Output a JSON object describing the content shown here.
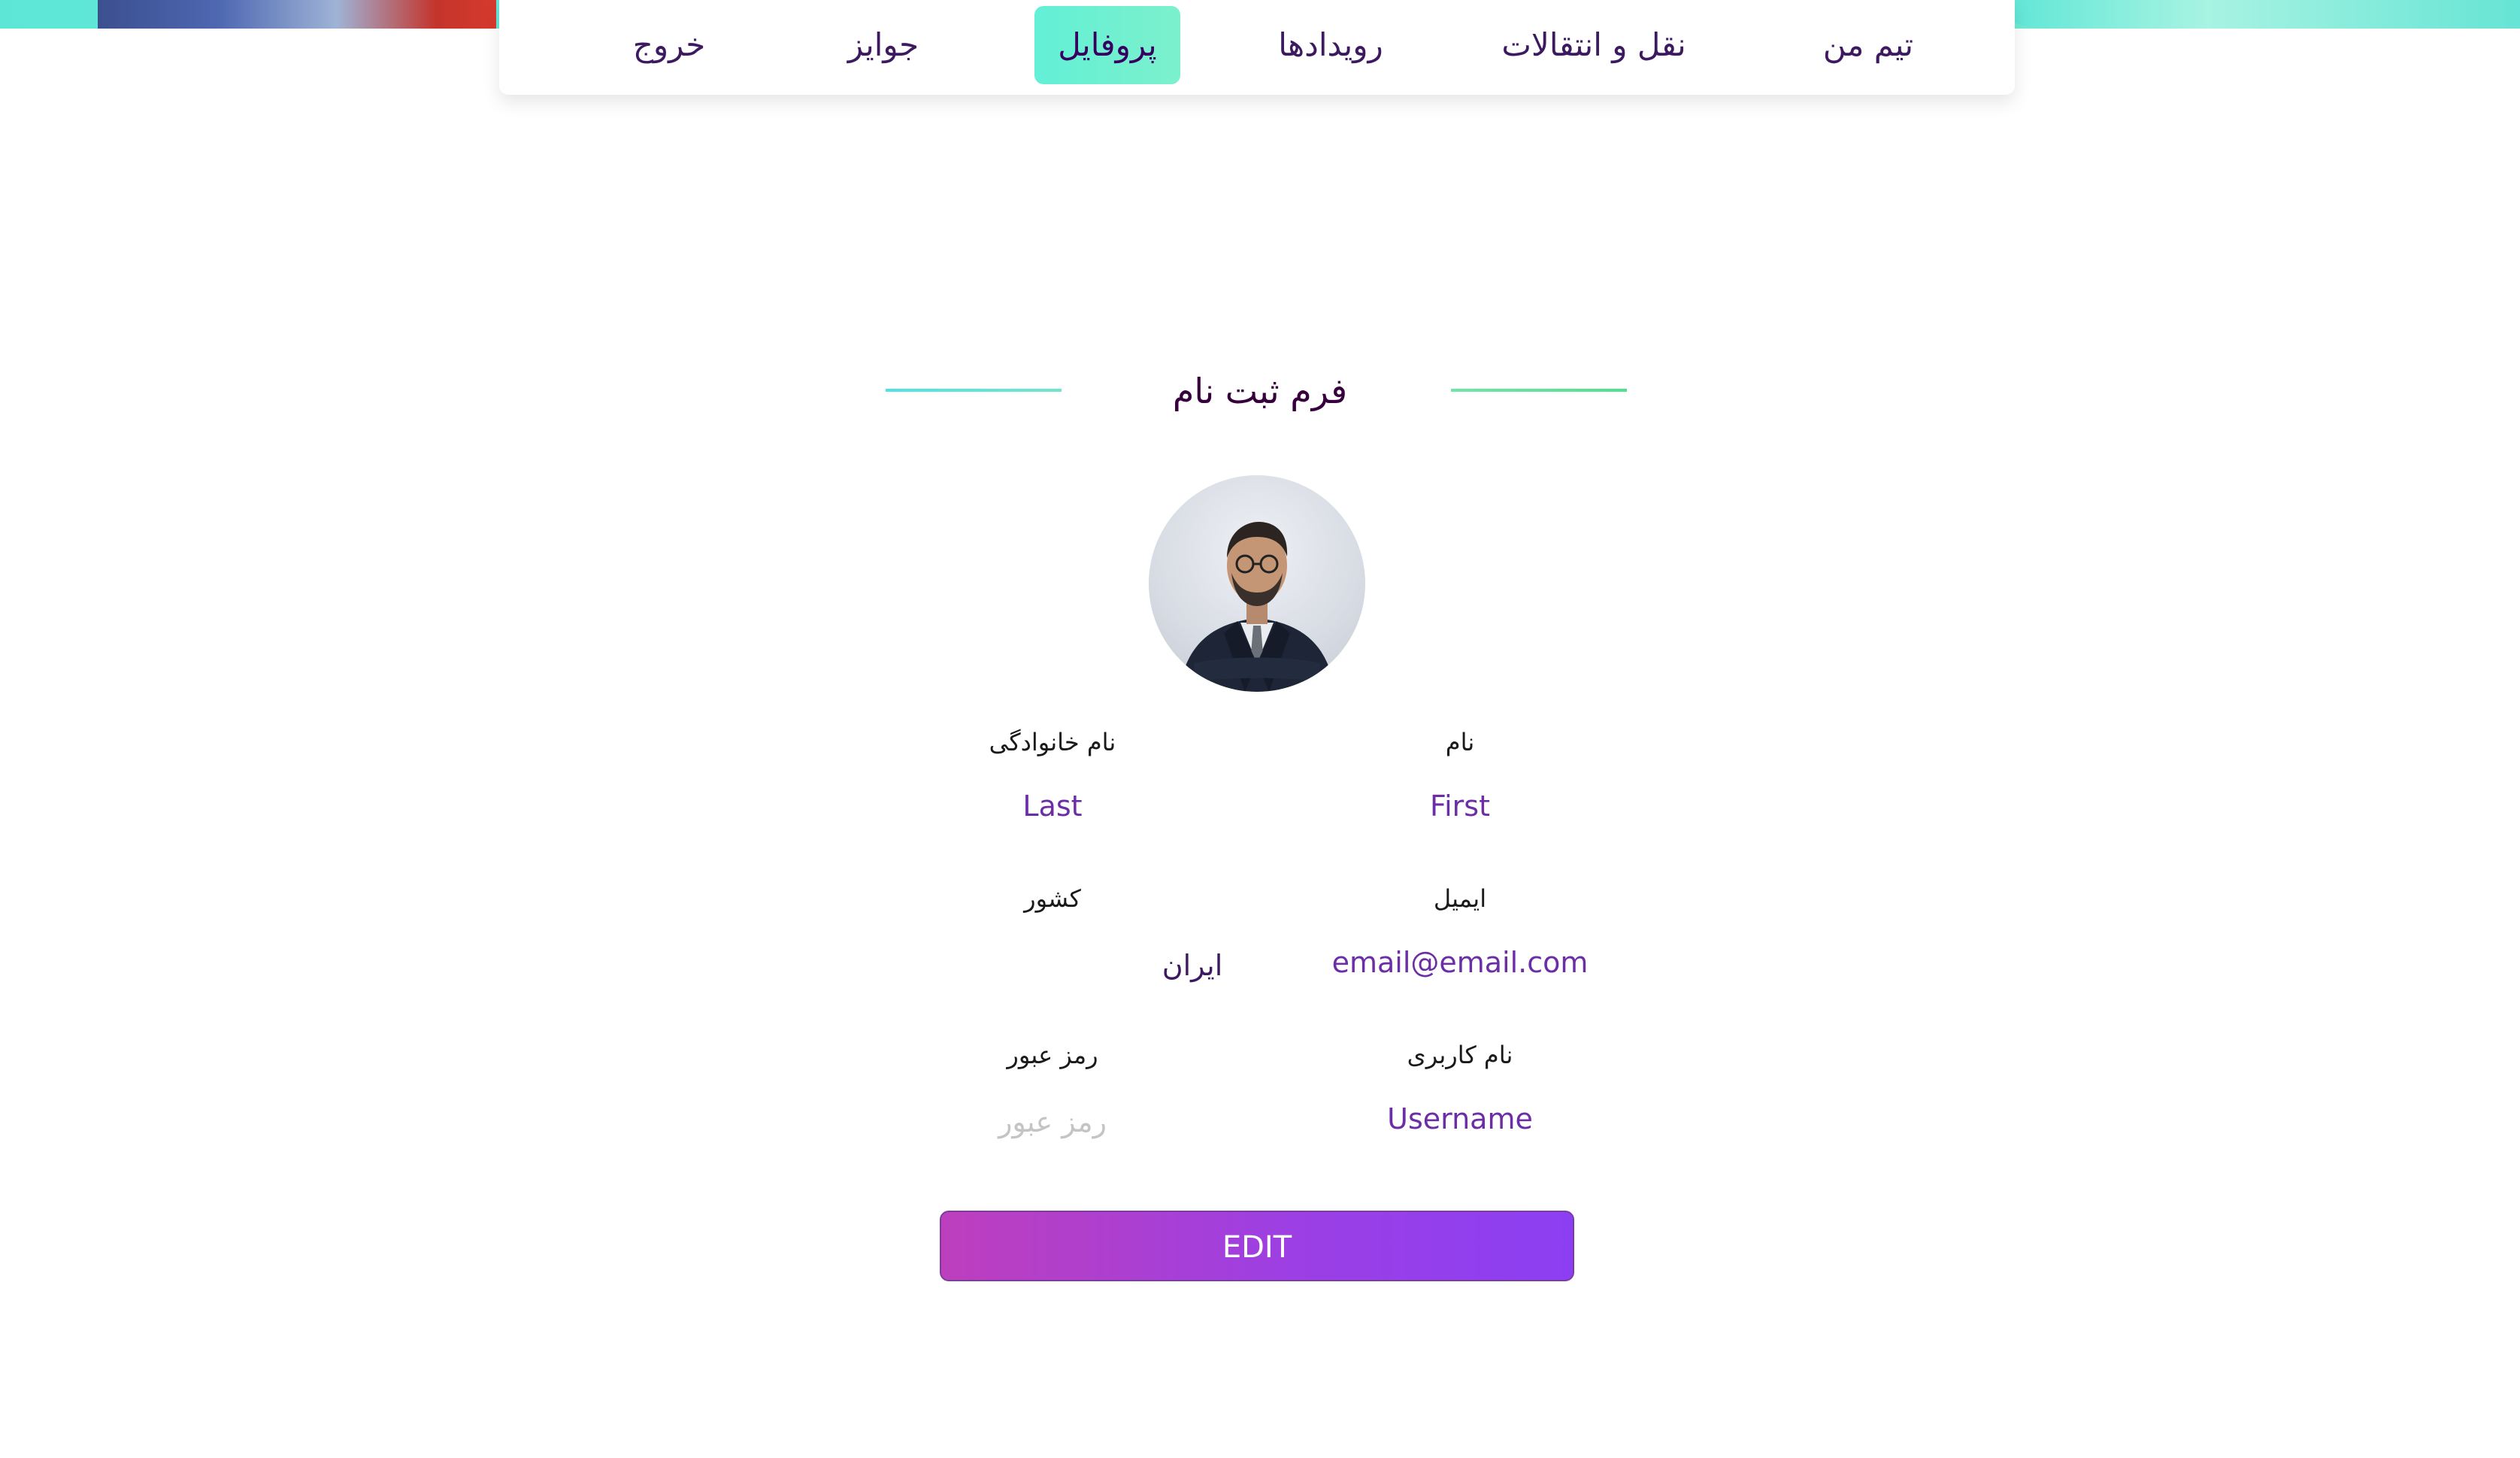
{
  "nav": {
    "items": [
      {
        "label": "تیم من"
      },
      {
        "label": "نقل و انتقالات"
      },
      {
        "label": "رویدادها"
      },
      {
        "label": "پروفایل"
      },
      {
        "label": "جوایز"
      },
      {
        "label": "خروج"
      }
    ],
    "active_item": "پروفایل"
  },
  "form": {
    "title": "فرم ثبت نام",
    "fields": {
      "first_name": {
        "label": "نام",
        "value": "First"
      },
      "last_name": {
        "label": "نام خانوادگی",
        "value": "Last"
      },
      "email": {
        "label": "ایمیل",
        "value": "email@email.com"
      },
      "country": {
        "label": "کشور",
        "value": "ایران"
      },
      "username": {
        "label": "نام کاربری",
        "value": "Username"
      },
      "password": {
        "label": "رمز عبور",
        "placeholder": "رمز عبور"
      }
    },
    "submit_label": "EDIT"
  },
  "colors": {
    "accent_active": "#62f0d6",
    "value_text": "#6b2ea6",
    "button_gradient_start": "#bd3fbd",
    "button_gradient_end": "#8c3ff2"
  }
}
